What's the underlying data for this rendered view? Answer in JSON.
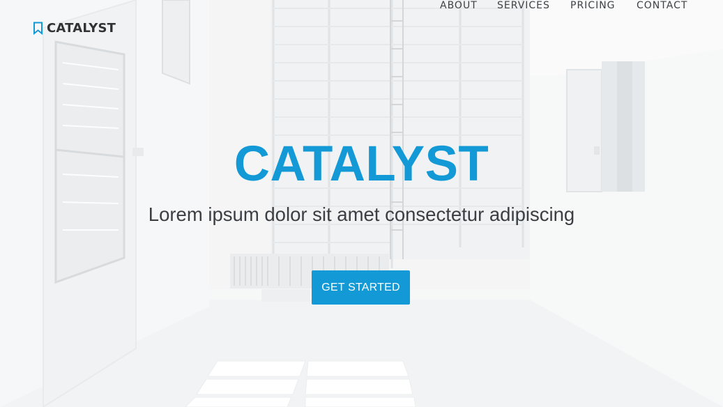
{
  "brand": {
    "name": "CATALYST",
    "icon": "bookmark-icon",
    "icon_color": "#139ad6"
  },
  "nav": {
    "items": [
      {
        "label": "ABOUT"
      },
      {
        "label": "SERVICES"
      },
      {
        "label": "PRICING"
      },
      {
        "label": "CONTACT"
      }
    ]
  },
  "hero": {
    "title": "CATALYST",
    "subtitle": "Lorem ipsum dolor sit amet consectetur adipiscing",
    "cta_label": "GET STARTED"
  },
  "colors": {
    "accent": "#139ad6",
    "nav_text": "#3d4145",
    "subtitle_text": "#3b3f43",
    "background": "#f4f5f6"
  }
}
